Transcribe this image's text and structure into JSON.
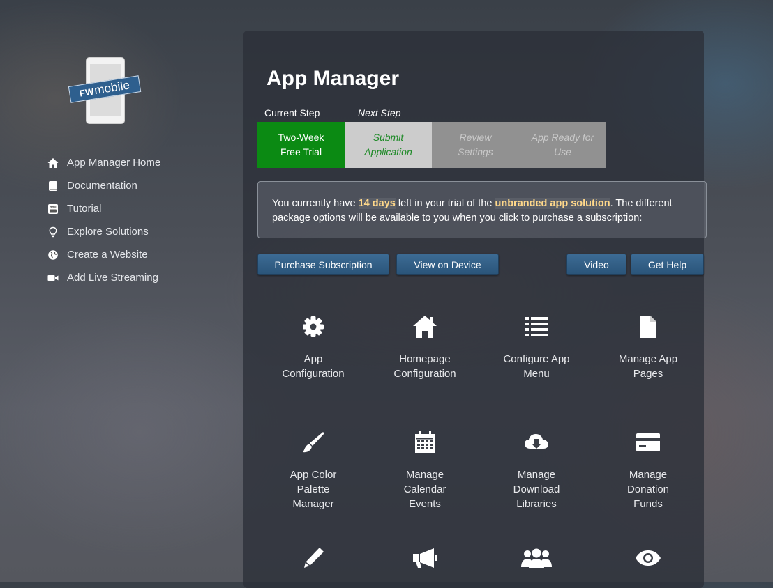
{
  "logo": {
    "brand_bold": "FW",
    "brand_rest": "mobile"
  },
  "sidebar": {
    "items": [
      {
        "label": "App Manager Home",
        "icon": "home-icon"
      },
      {
        "label": "Documentation",
        "icon": "book-icon"
      },
      {
        "label": "Tutorial",
        "icon": "youtube-icon"
      },
      {
        "label": "Explore Solutions",
        "icon": "lightbulb-icon"
      },
      {
        "label": "Create a Website",
        "icon": "globe-icon"
      },
      {
        "label": "Add Live Streaming",
        "icon": "video-camera-icon"
      }
    ]
  },
  "main": {
    "title": "App Manager",
    "current_step_label": "Current Step",
    "next_step_label": "Next Step",
    "steps": [
      {
        "line1": "Two-Week",
        "line2": "Free Trial"
      },
      {
        "line1": "Submit",
        "line2": "Application"
      },
      {
        "line1": "Review",
        "line2": "Settings"
      },
      {
        "line1": "App Ready for",
        "line2": "Use"
      }
    ],
    "notice": {
      "pre": "You currently have ",
      "days": "14 days",
      "mid": " left in your trial of the ",
      "product": "unbranded app solution",
      "post": ". The different package options will be available to you when you click to purchase a subscription:"
    },
    "buttons": {
      "purchase": "Purchase Subscription",
      "view_device": "View on Device",
      "video": "Video",
      "help": "Get Help"
    },
    "tiles": [
      {
        "line1": "App",
        "line2": "Configuration",
        "line3": "",
        "icon": "gear-icon"
      },
      {
        "line1": "Homepage",
        "line2": "Configuration",
        "line3": "",
        "icon": "home-icon"
      },
      {
        "line1": "Configure App",
        "line2": "Menu",
        "line3": "",
        "icon": "list-icon"
      },
      {
        "line1": "Manage App",
        "line2": "Pages",
        "line3": "",
        "icon": "page-icon"
      },
      {
        "line1": "App Color",
        "line2": "Palette",
        "line3": "Manager",
        "icon": "paintbrush-icon"
      },
      {
        "line1": "Manage",
        "line2": "Calendar",
        "line3": "Events",
        "icon": "calendar-icon"
      },
      {
        "line1": "Manage",
        "line2": "Download",
        "line3": "Libraries",
        "icon": "cloud-download-icon"
      },
      {
        "line1": "Manage",
        "line2": "Donation",
        "line3": "Funds",
        "icon": "credit-card-icon"
      },
      {
        "line1": "",
        "line2": "",
        "line3": "",
        "icon": "pen-icon"
      },
      {
        "line1": "",
        "line2": "",
        "line3": "",
        "icon": "megaphone-icon"
      },
      {
        "line1": "",
        "line2": "",
        "line3": "",
        "icon": "users-icon"
      },
      {
        "line1": "",
        "line2": "",
        "line3": "",
        "icon": "eye-icon"
      }
    ]
  },
  "colors": {
    "step_current": "#0b8a13",
    "step_next": "#cccccc",
    "step_future": "#919191",
    "button": "#2f5b83",
    "highlight": "#ffd88a"
  }
}
